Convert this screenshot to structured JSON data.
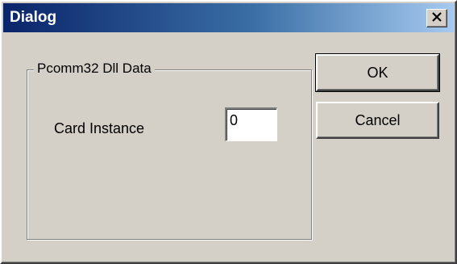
{
  "window": {
    "title": "Dialog",
    "close_icon": "close-icon"
  },
  "group": {
    "legend": "Pcomm32 Dll Data",
    "card_instance_label": "Card Instance",
    "card_instance_value": "0"
  },
  "buttons": {
    "ok_label": "OK",
    "cancel_label": "Cancel"
  },
  "colors": {
    "titlebar_start": "#0a246a",
    "titlebar_end": "#a6caf0",
    "face": "#d4d0c8"
  }
}
